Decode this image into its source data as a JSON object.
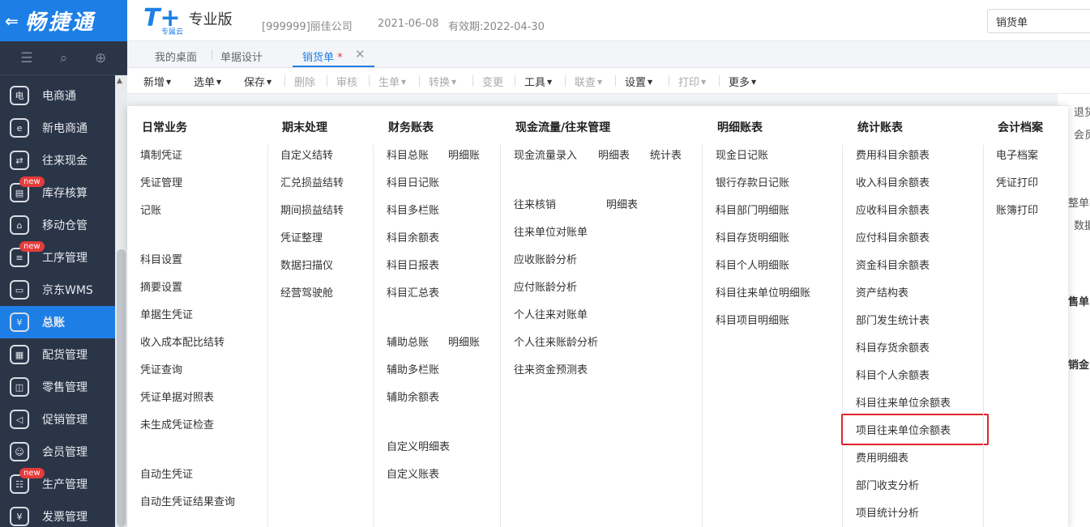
{
  "app": {
    "logo_name": "畅捷通",
    "back_glyph": "⇐"
  },
  "sidebar": {
    "tool_icons": [
      "menu-icon",
      "search-doc-icon",
      "add-doc-icon"
    ],
    "items": [
      {
        "label": "电商通",
        "icon": "shop-icon",
        "badge": ""
      },
      {
        "label": "新电商通",
        "icon": "ecommerce-icon",
        "badge": ""
      },
      {
        "label": "往来现金",
        "icon": "exchange-icon",
        "badge": ""
      },
      {
        "label": "库存核算",
        "icon": "inventory-icon",
        "badge": "new"
      },
      {
        "label": "移动仓管",
        "icon": "warehouse-icon",
        "badge": ""
      },
      {
        "label": "工序管理",
        "icon": "process-icon",
        "badge": "new"
      },
      {
        "label": "京东WMS",
        "icon": "truck-icon",
        "badge": ""
      },
      {
        "label": "总账",
        "icon": "ledger-icon",
        "badge": "",
        "active": true
      },
      {
        "label": "配货管理",
        "icon": "distribution-icon",
        "badge": ""
      },
      {
        "label": "零售管理",
        "icon": "retail-icon",
        "badge": ""
      },
      {
        "label": "促销管理",
        "icon": "promotion-icon",
        "badge": ""
      },
      {
        "label": "会员管理",
        "icon": "member-icon",
        "badge": ""
      },
      {
        "label": "生产管理",
        "icon": "production-icon",
        "badge": "new"
      },
      {
        "label": "发票管理",
        "icon": "invoice-icon",
        "badge": ""
      }
    ]
  },
  "header": {
    "brand_t": "T+",
    "brand_sub": "专属云",
    "edition": "专业版",
    "company": "[999999]丽佳公司",
    "date": "2021-06-08",
    "expiry": "有效期:2022-04-30",
    "search_value": "销货单"
  },
  "tabs": {
    "items": [
      "我的桌面",
      "单据设计",
      "销货单"
    ],
    "active_marker": "*",
    "close_glyph": "✕"
  },
  "toolbar": {
    "items": [
      {
        "label": "新增",
        "dropdown": true,
        "disabled": false
      },
      {
        "label": "选单",
        "dropdown": true,
        "disabled": false
      },
      {
        "label": "保存",
        "dropdown": true,
        "disabled": false
      },
      {
        "label": "删除",
        "dropdown": false,
        "disabled": true
      },
      {
        "label": "审核",
        "dropdown": false,
        "disabled": true
      },
      {
        "label": "生单",
        "dropdown": true,
        "disabled": true
      },
      {
        "label": "转换",
        "dropdown": true,
        "disabled": true
      },
      {
        "label": "变更",
        "dropdown": false,
        "disabled": true
      },
      {
        "label": "工具",
        "dropdown": true,
        "disabled": false
      },
      {
        "label": "联查",
        "dropdown": true,
        "disabled": true
      },
      {
        "label": "设置",
        "dropdown": true,
        "disabled": false
      },
      {
        "label": "打印",
        "dropdown": true,
        "disabled": true
      },
      {
        "label": "更多",
        "dropdown": true,
        "disabled": false
      }
    ]
  },
  "right_stub": {
    "texts": [
      "退货",
      "会员",
      "整单折",
      "数据",
      "售单",
      "销金"
    ]
  },
  "menu": {
    "columns": {
      "daily": {
        "title": "日常业务",
        "items": [
          "填制凭证",
          "凭证管理",
          "记账",
          "科目设置",
          "摘要设置",
          "单据生凭证",
          "收入成本配比结转",
          "凭证查询",
          "凭证单据对照表",
          "未生成凭证检查",
          "自动生凭证",
          "自动生凭证结果查询"
        ]
      },
      "period_end": {
        "title": "期末处理",
        "items": [
          "自定义结转",
          "汇兑损益结转",
          "期间损益结转",
          "凭证整理",
          "数据扫描仪",
          "经营驾驶舱"
        ]
      },
      "finance": {
        "title": "财务账表",
        "items": [
          "科目总账",
          "明细账",
          "科目日记账",
          "科目多栏账",
          "科目余额表",
          "科目日报表",
          "科目汇总表",
          "辅助总账",
          "明细账",
          "辅助多栏账",
          "辅助余额表",
          "自定义明细表",
          "自定义账表"
        ]
      },
      "cashflow": {
        "title": "现金流量/往来管理",
        "items": [
          "现金流量录入",
          "明细表",
          "统计表",
          "往来核销",
          "明细表",
          "往来单位对账单",
          "应收账龄分析",
          "应付账龄分析",
          "个人往来对账单",
          "个人往来账龄分析",
          "往来资金预测表"
        ]
      },
      "detail": {
        "title": "明细账表",
        "items": [
          "现金日记账",
          "银行存款日记账",
          "科目部门明细账",
          "科目存货明细账",
          "科目个人明细账",
          "科目往来单位明细账",
          "科目项目明细账"
        ]
      },
      "stats": {
        "title": "统计账表",
        "items": [
          "费用科目余额表",
          "收入科目余额表",
          "应收科目余额表",
          "应付科目余额表",
          "资金科目余额表",
          "资产结构表",
          "部门发生统计表",
          "科目存货余额表",
          "科目个人余额表",
          "科目往来单位余额表",
          "项目往来单位余额表",
          "费用明细表",
          "部门收支分析",
          "项目统计分析"
        ]
      },
      "archive": {
        "title": "会计档案",
        "items": [
          "电子档案",
          "凭证打印",
          "账簿打印"
        ]
      }
    }
  }
}
